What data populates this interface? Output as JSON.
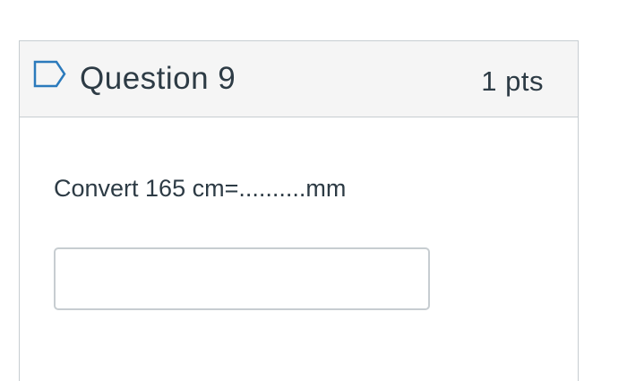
{
  "question": {
    "flag_icon": "bookmark-flag-icon",
    "title": "Question 9",
    "points": "1 pts",
    "text": "Convert 165 cm=..........mm"
  },
  "answer": {
    "value": "",
    "placeholder": ""
  },
  "colors": {
    "header_bg": "#f5f5f5",
    "border": "#c7cdd1",
    "text": "#2d3b45",
    "flag_stroke": "#2b7abc"
  }
}
